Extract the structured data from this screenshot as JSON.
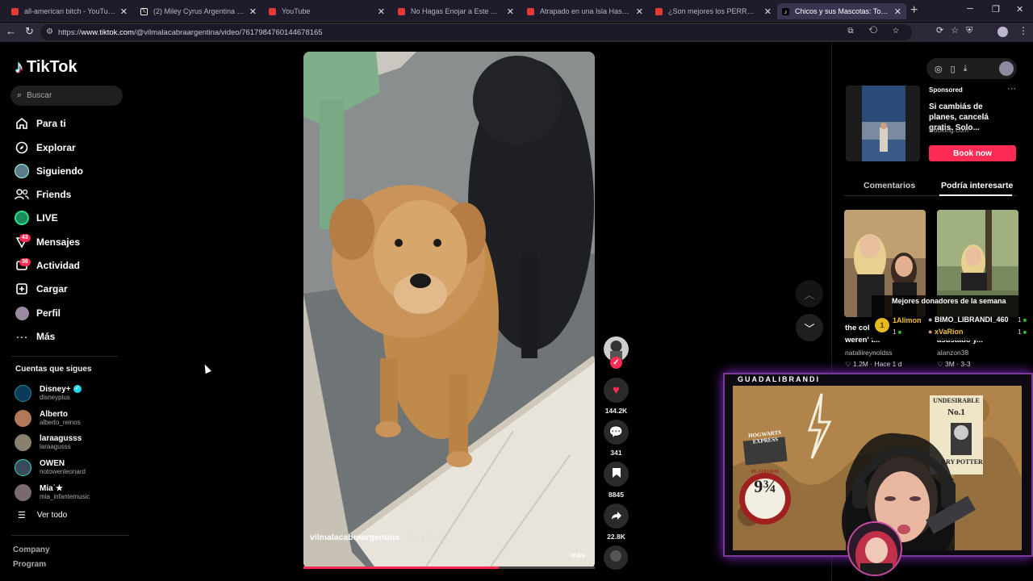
{
  "browser": {
    "tabs": [
      {
        "title": "all-american bitch - YouTube",
        "color": "#e53935"
      },
      {
        "title": "(2) Miley Cyrus Argentina en X: \"D",
        "color": "#ffffff"
      },
      {
        "title": "YouTube",
        "color": "#e53935"
      },
      {
        "title": "No Hagas Enojar a Este Artista - Y",
        "color": "#e53935"
      },
      {
        "title": "Atrapado en una Isla Hasta que C",
        "color": "#e53935"
      },
      {
        "title": "¿Son mejores los PERROS o GATO",
        "color": "#e53935"
      },
      {
        "title": "Chicos y sus Mascotas: Tortas Frita",
        "color": "#ffffff"
      }
    ],
    "url_prefix": "https://",
    "url_domain": "www.tiktok.com",
    "url_path": "/@vilmalacabraargentina/video/7617984760144678165"
  },
  "sidebar": {
    "logo_text": "TikTok",
    "search_placeholder": "Buscar",
    "nav": [
      {
        "label": "Para ti",
        "icon": "home-icon"
      },
      {
        "label": "Explorar",
        "icon": "compass-icon"
      },
      {
        "label": "Siguiendo",
        "icon": "following-avatar-icon"
      },
      {
        "label": "Friends",
        "icon": "friends-icon"
      },
      {
        "label": "LIVE",
        "icon": "live-icon"
      },
      {
        "label": "Mensajes",
        "icon": "messages-icon",
        "badge": "43"
      },
      {
        "label": "Actividad",
        "icon": "activity-icon",
        "badge": "36"
      },
      {
        "label": "Cargar",
        "icon": "upload-icon"
      },
      {
        "label": "Perfil",
        "icon": "profile-avatar-icon"
      },
      {
        "label": "Más",
        "icon": "more-icon"
      }
    ],
    "following_title": "Cuentas que sigues",
    "following": [
      {
        "name": "Disney+",
        "handle": "disneyplus",
        "verified": true
      },
      {
        "name": "Alberto",
        "handle": "alberto_reinos"
      },
      {
        "name": "laraagusss",
        "handle": "laraagusss"
      },
      {
        "name": "OWEN",
        "handle": "notowenleonard"
      },
      {
        "name": "Mia˙★",
        "handle": "mia_infantemusic"
      }
    ],
    "see_all": "Ver todo",
    "footer": [
      "Company",
      "Program"
    ]
  },
  "video": {
    "author": "vilmalacabraargentina",
    "time": "· Hace 6 d",
    "more": "más",
    "progress": 0.67
  },
  "actions": {
    "likes": "144.2K",
    "comments": "341",
    "saves": "8845",
    "shares": "22.8K"
  },
  "right_panel": {
    "ad": {
      "sponsored": "Sponsored",
      "text": "Si cambiás de planes, cancelá gratis. Solo...",
      "source": "Booking.com",
      "button": "Book now"
    },
    "tabs": [
      "Comentarios",
      "Podría interesarte"
    ],
    "suggested": [
      {
        "caption1": "the col",
        "caption2": "weren' t...",
        "user": "nataliireynoldss",
        "stats": "♡ 1.2M · Hace 1 d"
      },
      {
        "caption1": "",
        "caption2": "asustado y...",
        "user": "alanzon38",
        "stats": "♡ 3M · 3-3"
      }
    ]
  },
  "stream": {
    "donors_title": "Mejores donadores de la semana",
    "donors": [
      {
        "name": "1Alimon",
        "count": "1",
        "color": "#f2c230"
      },
      {
        "name": "BIMO_LIBRANDI_460",
        "count": "1",
        "color": "#ffffff"
      },
      {
        "name": "xVaRion",
        "count": "1",
        "color": "#f2c230"
      }
    ],
    "webcam_title": "GUADALIBRANDI",
    "posters": {
      "hogwarts": "HOGWARTS EXPRESS",
      "platform": "PLATFORM",
      "platform_num": "9¾",
      "undesirable": "UNDESIRABLE",
      "no1": "No.1",
      "harry": "RRY POTTER"
    }
  }
}
